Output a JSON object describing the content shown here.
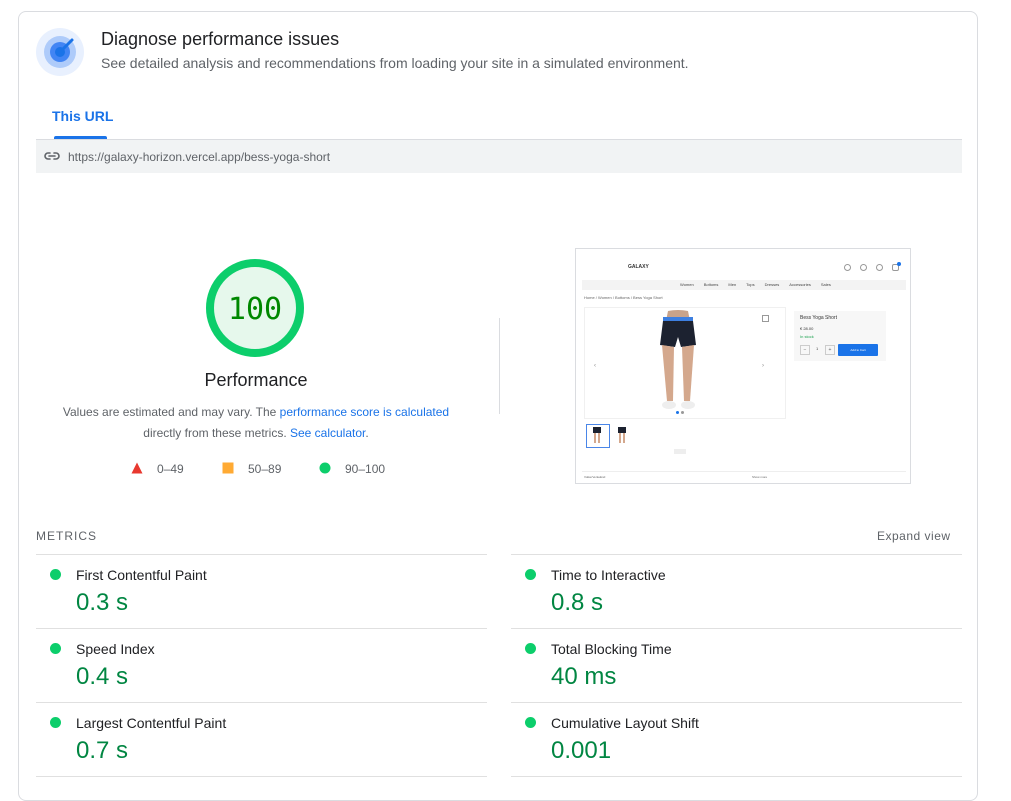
{
  "header": {
    "title": "Diagnose performance issues",
    "subtitle": "See detailed analysis and recommendations from loading your site in a simulated environment.",
    "icon": "speedometer-icon"
  },
  "tabs": [
    {
      "label": "This URL",
      "active": true
    }
  ],
  "url": "https://galaxy-horizon.vercel.app/bess-yoga-short",
  "score": {
    "value": "100",
    "fraction": 1.0,
    "label": "Performance",
    "color": "#0cce6b"
  },
  "description": {
    "prefix": "Values are estimated and may vary. The ",
    "link1": "performance score is calculated",
    "middle": "directly from these metrics. ",
    "link2": "See calculator",
    "suffix": "."
  },
  "legend": [
    {
      "shape": "triangle",
      "color": "#e8382f",
      "label": "0–49"
    },
    {
      "shape": "square",
      "color": "#ffaa33",
      "label": "50–89"
    },
    {
      "shape": "circle",
      "color": "#0cce6b",
      "label": "90–100"
    }
  ],
  "screenshot": {
    "logo": "GALAXY",
    "nav": [
      "Women",
      "Bottoms",
      "Men",
      "Tops",
      "Dresses",
      "Accessories",
      "Sales"
    ],
    "breadcrumb": "Home / Women / Bottoms / Bess Yoga Short",
    "product_title": "Bess Yoga Short",
    "price": "€ 28.00",
    "stock": "In stock",
    "qty": "1",
    "cta": "Add to Cart",
    "footer_left": "VolkerVerkeEnd",
    "footer_right": "Show more"
  },
  "metrics": {
    "heading": "METRICS",
    "expand_label": "Expand view",
    "items": [
      {
        "name": "First Contentful Paint",
        "value": "0.3 s"
      },
      {
        "name": "Time to Interactive",
        "value": "0.8 s"
      },
      {
        "name": "Speed Index",
        "value": "0.4 s"
      },
      {
        "name": "Total Blocking Time",
        "value": "40 ms"
      },
      {
        "name": "Largest Contentful Paint",
        "value": "0.7 s"
      },
      {
        "name": "Cumulative Layout Shift",
        "value": "0.001"
      }
    ]
  }
}
